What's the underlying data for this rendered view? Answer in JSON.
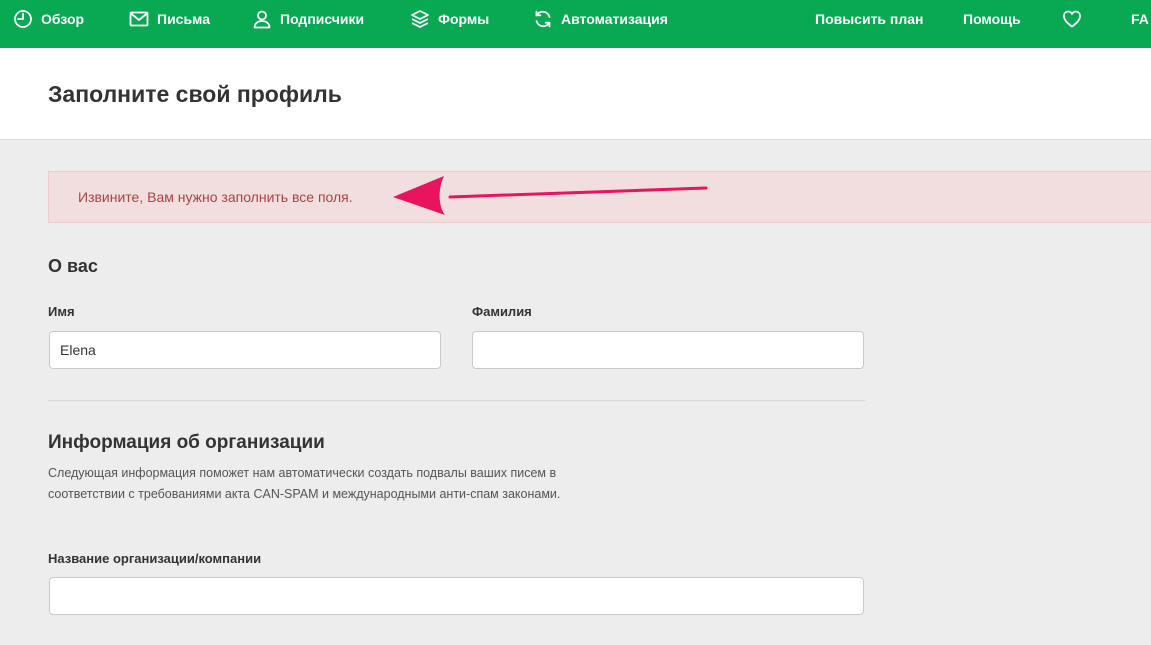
{
  "nav": {
    "items": [
      {
        "label": "Обзор",
        "icon": "clock-icon"
      },
      {
        "label": "Письма",
        "icon": "envelope-icon"
      },
      {
        "label": "Подписчики",
        "icon": "user-icon"
      },
      {
        "label": "Формы",
        "icon": "layers-icon"
      },
      {
        "label": "Автоматизация",
        "icon": "refresh-icon"
      }
    ],
    "upgrade_label": "Повысить план",
    "help_label": "Помощь",
    "favorite_icon": "heart-icon",
    "account_label": "FA"
  },
  "page": {
    "title": "Заполните свой профиль"
  },
  "alert": {
    "text": "Извините, Вам нужно заполнить все поля."
  },
  "about": {
    "title": "О вас",
    "first_name_label": "Имя",
    "first_name_value": "Elena",
    "last_name_label": "Фамилия",
    "last_name_value": ""
  },
  "organization": {
    "title": "Информация об организации",
    "description": "Следующая информация поможет нам автоматически создать подвалы ваших писем в соответствии с требованиями акта CAN-SPAM и международными анти-спам законами.",
    "company_label": "Название организации/компании",
    "company_value": ""
  },
  "colors": {
    "brand": "#09a853",
    "alert_bg": "#f2dedf",
    "alert_text": "#a94442",
    "annotation_arrow": "#e8145e"
  }
}
